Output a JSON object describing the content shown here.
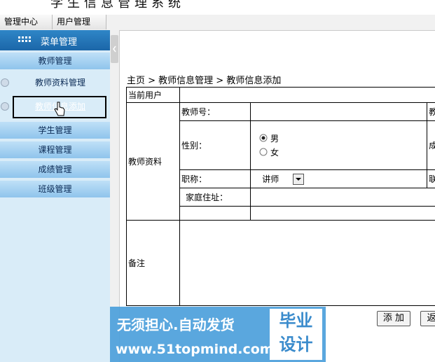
{
  "app": {
    "title": "学生信息管理系统"
  },
  "topnav": {
    "tabs": [
      "管理中心",
      "用户管理"
    ]
  },
  "sidebar": {
    "header": "菜单管理",
    "items": [
      {
        "label": "教师管理"
      },
      {
        "label": "教师资料管理"
      },
      {
        "label": "教师信息添加"
      },
      {
        "label": "学生管理"
      },
      {
        "label": "课程管理"
      },
      {
        "label": "成绩管理"
      },
      {
        "label": "班级管理"
      }
    ]
  },
  "breadcrumb": {
    "text": "主页 > 教师信息管理 > 教师信息添加"
  },
  "form": {
    "current_user_label": "当前用户",
    "section_label": "教师资料",
    "teacher_no_label": "教师号：",
    "gender_label": "性别：",
    "gender_options": [
      "男",
      "女"
    ],
    "gender_selected": "男",
    "title_label": "职称：",
    "title_value": "讲师",
    "address_label": "家庭住址：",
    "notes_label": "备注",
    "right_col_partial": [
      "教",
      "成",
      "联"
    ]
  },
  "buttons": {
    "add": "添 加",
    "back": "返"
  },
  "watermark": {
    "line1": "无须担心.自动发货",
    "line2": "www.51topmind.com",
    "box_top": "毕业",
    "box_bottom": "设计"
  },
  "colors": {
    "sidebar_bg": "#d9ecf8",
    "menu_header": "#1b66a8",
    "watermark": "#4da0dc"
  }
}
